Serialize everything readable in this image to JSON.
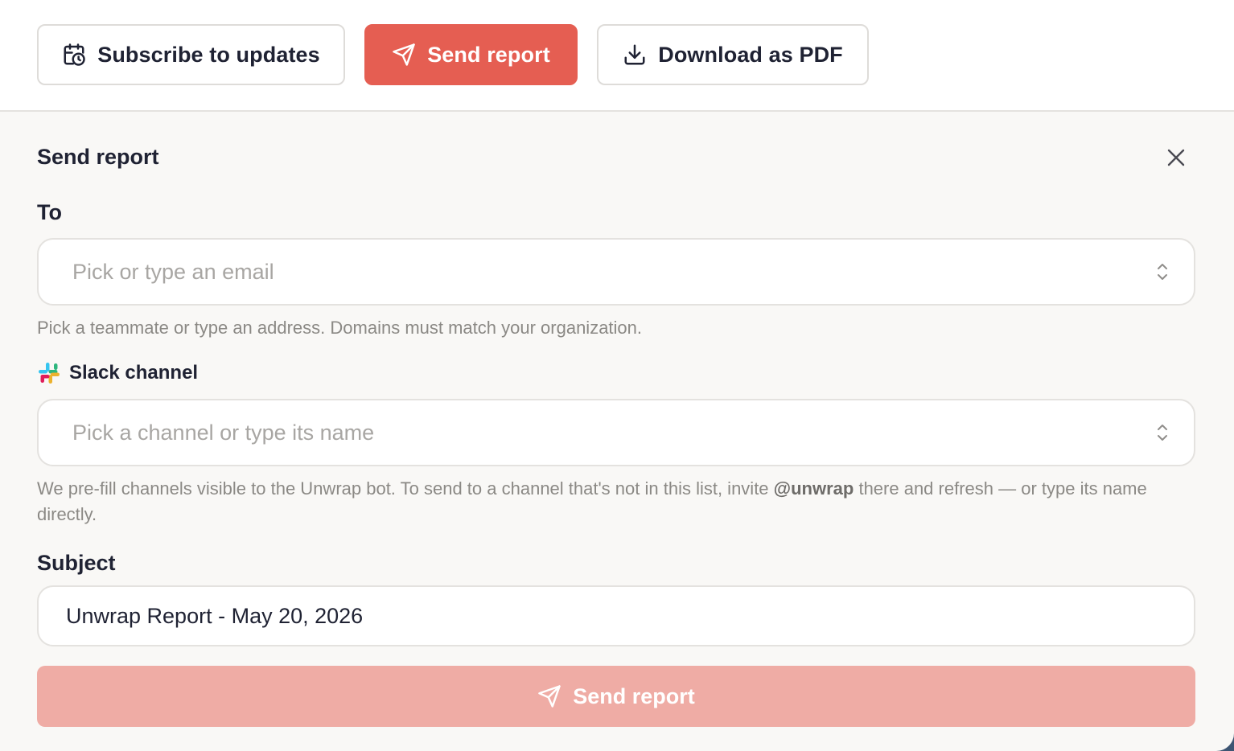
{
  "toolbar": {
    "subscribe_label": "Subscribe to updates",
    "send_label": "Send report",
    "download_label": "Download as PDF"
  },
  "panel": {
    "title": "Send report",
    "to": {
      "label": "To",
      "placeholder": "Pick or type an email",
      "hint": "Pick a teammate or type an address. Domains must match your organization."
    },
    "slack": {
      "label": "Slack channel",
      "placeholder": "Pick a channel or type its name",
      "hint_before": "We pre-fill channels visible to the Unwrap bot. To send to a channel that's not in this list, invite ",
      "hint_bold": "@unwrap",
      "hint_after": " there and refresh — or type its name directly."
    },
    "subject": {
      "label": "Subject",
      "value": "Unwrap Report - May 20, 2026"
    },
    "submit_label": "Send report"
  },
  "colors": {
    "accent": "#e55e52",
    "accent_disabled": "#efaca5",
    "text": "#1f2233",
    "muted": "#8b8985"
  },
  "icons": [
    "calendar-clock-icon",
    "send-icon",
    "download-icon",
    "close-icon",
    "chevron-up-down-icon",
    "slack-icon"
  ]
}
